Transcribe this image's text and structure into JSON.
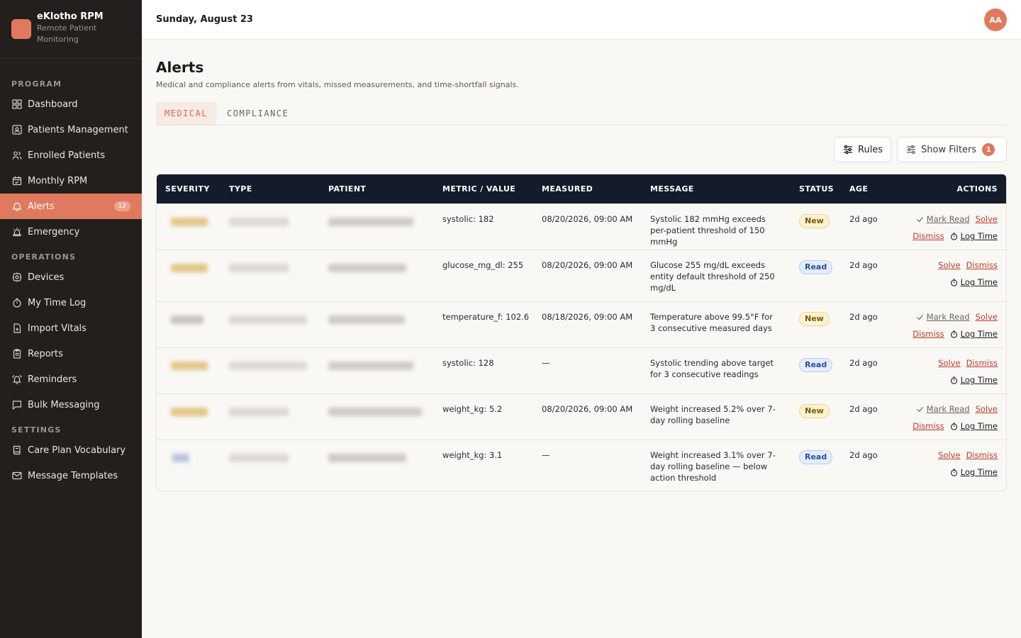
{
  "app": {
    "name": "eKlotho RPM",
    "subtitle": "Remote Patient Monitoring"
  },
  "sidebar": {
    "sections": [
      {
        "label": "PROGRAM",
        "items": [
          {
            "label": "Dashboard",
            "icon": "grid-icon"
          },
          {
            "label": "Patients Management",
            "icon": "id-card-icon"
          },
          {
            "label": "Enrolled Patients",
            "icon": "users-icon"
          },
          {
            "label": "Monthly RPM",
            "icon": "calendar-icon"
          },
          {
            "label": "Alerts",
            "icon": "bell-icon",
            "active": true,
            "badge": "12"
          },
          {
            "label": "Emergency",
            "icon": "siren-icon"
          }
        ]
      },
      {
        "label": "OPERATIONS",
        "items": [
          {
            "label": "Devices",
            "icon": "device-icon"
          },
          {
            "label": "My Time Log",
            "icon": "stopwatch-icon"
          },
          {
            "label": "Import Vitals",
            "icon": "file-plus-icon"
          },
          {
            "label": "Reports",
            "icon": "clipboard-icon"
          },
          {
            "label": "Reminders",
            "icon": "bell-ring-icon"
          },
          {
            "label": "Bulk Messaging",
            "icon": "message-icon"
          }
        ]
      },
      {
        "label": "SETTINGS",
        "items": [
          {
            "label": "Care Plan Vocabulary",
            "icon": "book-icon"
          },
          {
            "label": "Message Templates",
            "icon": "mail-icon"
          }
        ]
      }
    ]
  },
  "topbar": {
    "date": "Sunday, August 23",
    "avatar_initials": "AA"
  },
  "page": {
    "title": "Alerts",
    "subtitle": "Medical and compliance alerts from vitals, missed measurements, and time-shortfall signals.",
    "tabs": [
      "MEDICAL",
      "COMPLIANCE"
    ],
    "rules_label": "Rules",
    "filters_label": "Show Filters",
    "filters_count": "1"
  },
  "table": {
    "columns": [
      "SEVERITY",
      "TYPE",
      "PATIENT",
      "METRIC / VALUE",
      "MEASURED",
      "MESSAGE",
      "STATUS",
      "AGE",
      "ACTIONS"
    ],
    "rows": [
      {
        "metric": "systolic: 182",
        "measured": "08/20/2026, 09:00 AM",
        "message": "Systolic 182 mmHg exceeds per-patient threshold of 150 mmHg",
        "status": "New",
        "age": "2d ago"
      },
      {
        "metric": "glucose_mg_dl: 255",
        "measured": "08/20/2026, 09:00 AM",
        "message": "Glucose 255 mg/dL exceeds entity default threshold of 250 mg/dL",
        "status": "Read",
        "age": "2d ago"
      },
      {
        "metric": "temperature_f: 102.6",
        "measured": "08/18/2026, 09:00 AM",
        "message": "Temperature above 99.5°F for 3 consecutive measured days",
        "status": "New",
        "age": "2d ago"
      },
      {
        "metric": "systolic: 128",
        "measured": "—",
        "message": "Systolic trending above target for 3 consecutive readings",
        "status": "Read",
        "age": "2d ago"
      },
      {
        "metric": "weight_kg: 5.2",
        "measured": "08/20/2026, 09:00 AM",
        "message": "Weight increased 5.2% over 7-day rolling baseline",
        "status": "New",
        "age": "2d ago"
      },
      {
        "metric": "weight_kg: 3.1",
        "measured": "—",
        "message": "Weight increased 3.1% over 7-day rolling baseline — below action threshold",
        "status": "Read",
        "age": "2d ago"
      }
    ],
    "action_labels": {
      "mark_read": "Mark Read",
      "solve": "Solve",
      "dismiss": "Dismiss",
      "log_time": "Log Time"
    }
  },
  "colors": {
    "accent": "#e07a5f",
    "sidebar_bg": "#221f1c",
    "table_header_bg": "#141b2b"
  }
}
